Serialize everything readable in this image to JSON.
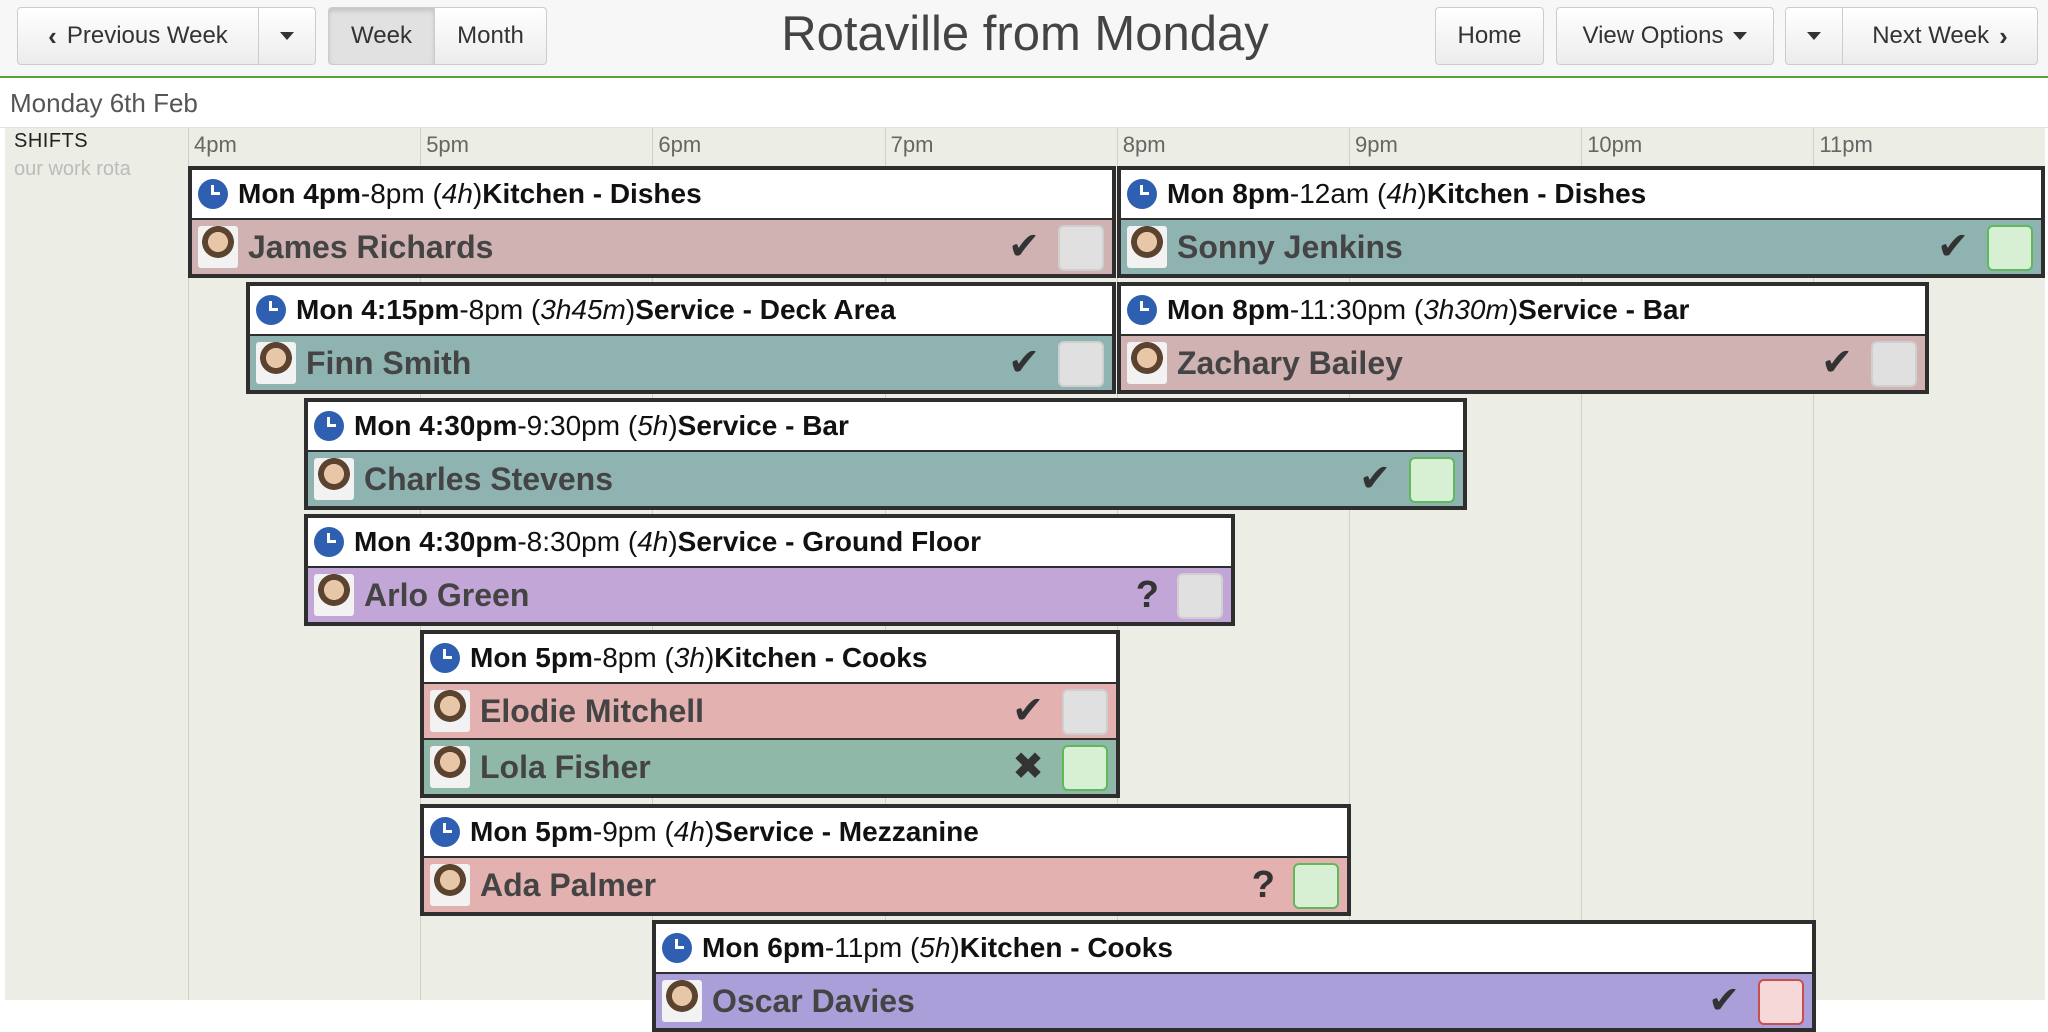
{
  "nav": {
    "previous_week": "Previous Week",
    "week": "Week",
    "month": "Month",
    "home": "Home",
    "view_options": "View Options",
    "next_week": "Next Week"
  },
  "title": "Rotaville from Monday",
  "date_label": "Monday 6th Feb",
  "sidebar": {
    "title": "SHIFTS",
    "subtitle": "our work rota"
  },
  "hours": [
    "4pm",
    "5pm",
    "6pm",
    "7pm",
    "8pm",
    "9pm",
    "10pm",
    "11pm"
  ],
  "shifts": [
    {
      "start": "Mon 4pm",
      "end": "8pm",
      "duration": "4h",
      "area": "Kitchen - Dishes",
      "people": [
        {
          "name": "James Richards",
          "status": "✔",
          "check": "grey",
          "color": "pink"
        }
      ]
    },
    {
      "start": "Mon 8pm",
      "end": "12am",
      "duration": "4h",
      "area": "Kitchen - Dishes",
      "people": [
        {
          "name": "Sonny Jenkins",
          "status": "✔",
          "check": "green",
          "color": "teal"
        }
      ]
    },
    {
      "start": "Mon 4:15pm",
      "end": "8pm",
      "duration": "3h45m",
      "area": "Service - Deck Area",
      "people": [
        {
          "name": "Finn Smith",
          "status": "✔",
          "check": "grey",
          "color": "teal"
        }
      ]
    },
    {
      "start": "Mon 8pm",
      "end": "11:30pm",
      "duration": "3h30m",
      "area": "Service - Bar",
      "people": [
        {
          "name": "Zachary Bailey",
          "status": "✔",
          "check": "grey",
          "color": "pink"
        }
      ]
    },
    {
      "start": "Mon 4:30pm",
      "end": "9:30pm",
      "duration": "5h",
      "area": "Service - Bar",
      "people": [
        {
          "name": "Charles Stevens",
          "status": "✔",
          "check": "green",
          "color": "teal"
        }
      ]
    },
    {
      "start": "Mon 4:30pm",
      "end": "8:30pm",
      "duration": "4h",
      "area": "Service - Ground Floor",
      "people": [
        {
          "name": "Arlo Green",
          "status": "?",
          "check": "grey",
          "color": "purple"
        }
      ]
    },
    {
      "start": "Mon 5pm",
      "end": "8pm",
      "duration": "3h",
      "area": "Kitchen - Cooks",
      "people": [
        {
          "name": "Elodie Mitchell",
          "status": "✔",
          "check": "grey",
          "color": "salmon"
        },
        {
          "name": "Lola Fisher",
          "status": "✖",
          "check": "green",
          "color": "sage"
        }
      ]
    },
    {
      "start": "Mon 5pm",
      "end": "9pm",
      "duration": "4h",
      "area": "Service - Mezzanine",
      "people": [
        {
          "name": "Ada Palmer",
          "status": "?",
          "check": "green",
          "color": "salmon"
        }
      ]
    },
    {
      "start": "Mon 6pm",
      "end": "11pm",
      "duration": "5h",
      "area": "Kitchen - Cooks",
      "people": [
        {
          "name": "Oscar Davies",
          "status": "✔",
          "check": "red",
          "color": "lav"
        }
      ]
    }
  ]
}
